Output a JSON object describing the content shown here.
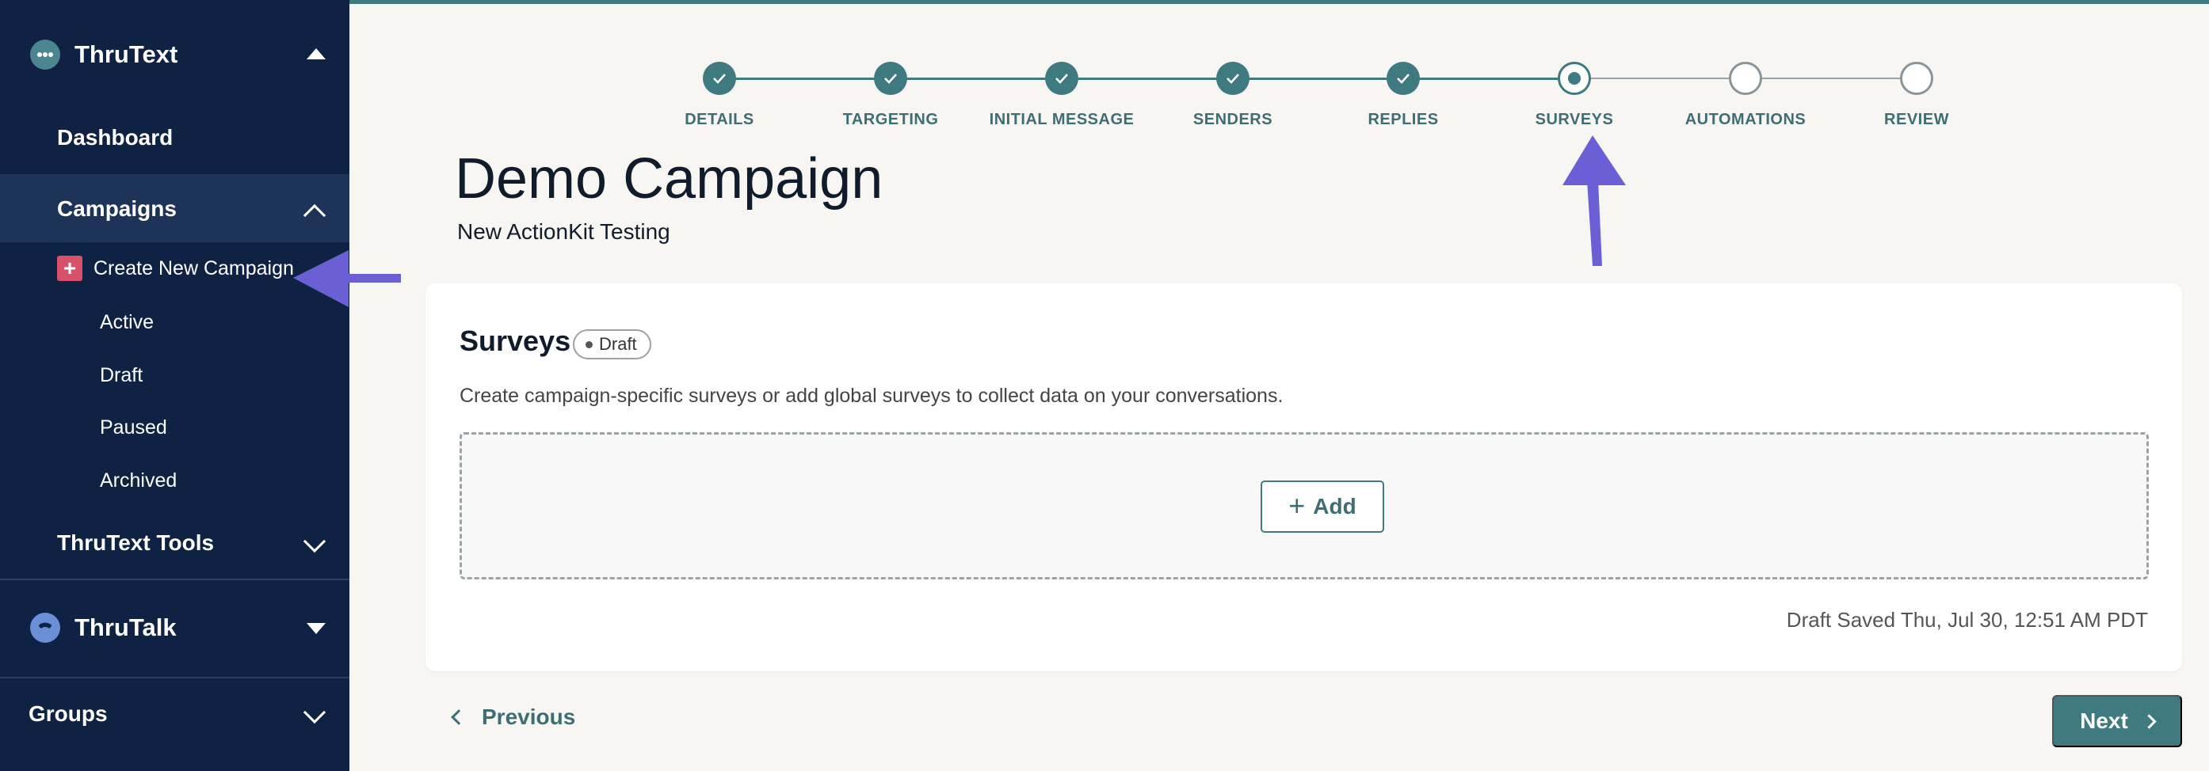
{
  "sidebar": {
    "thrutext": {
      "label": "ThruText",
      "icon": "thrutext-logo-icon"
    },
    "dashboard": "Dashboard",
    "campaigns": {
      "label": "Campaigns",
      "create": "Create New Campaign",
      "items": [
        "Active",
        "Draft",
        "Paused",
        "Archived"
      ]
    },
    "tools": "ThruText Tools",
    "thrutalk": {
      "label": "ThruTalk",
      "icon": "thrutalk-logo-icon"
    },
    "groups": "Groups"
  },
  "stepper": {
    "steps": [
      {
        "label": "DETAILS",
        "state": "done"
      },
      {
        "label": "TARGETING",
        "state": "done"
      },
      {
        "label": "INITIAL MESSAGE",
        "state": "done"
      },
      {
        "label": "SENDERS",
        "state": "done"
      },
      {
        "label": "REPLIES",
        "state": "done"
      },
      {
        "label": "SURVEYS",
        "state": "current"
      },
      {
        "label": "AUTOMATIONS",
        "state": "todo"
      },
      {
        "label": "REVIEW",
        "state": "todo"
      }
    ]
  },
  "campaign": {
    "title": "Demo Campaign",
    "subtitle": "New ActionKit Testing"
  },
  "surveys": {
    "title": "Surveys",
    "badge": "Draft",
    "description": "Create campaign-specific surveys or add global surveys to collect data on your conversations.",
    "add_label": "Add",
    "saved_text": "Draft Saved Thu, Jul 30, 12:51 AM PDT"
  },
  "footer": {
    "previous": "Previous",
    "next": "Next"
  },
  "colors": {
    "sidebar": "#0f2243",
    "accent": "#3e7a80",
    "arrow": "#6b5fd6",
    "create_icon": "#d6516a"
  }
}
